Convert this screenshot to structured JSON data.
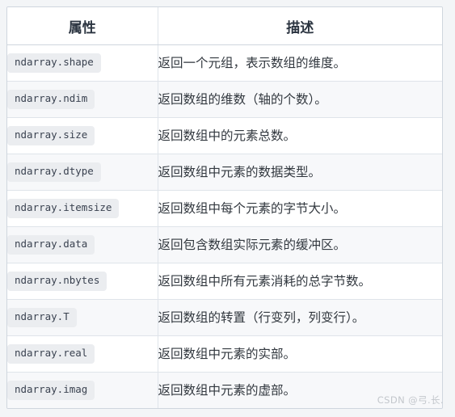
{
  "table": {
    "headers": [
      "属性",
      "描述"
    ],
    "rows": [
      {
        "attr": "ndarray.shape",
        "desc": "返回一个元组，表示数组的维度。"
      },
      {
        "attr": "ndarray.ndim",
        "desc": "返回数组的维数（轴的个数）。"
      },
      {
        "attr": "ndarray.size",
        "desc": "返回数组中的元素总数。"
      },
      {
        "attr": "ndarray.dtype",
        "desc": "返回数组中元素的数据类型。"
      },
      {
        "attr": "ndarray.itemsize",
        "desc": "返回数组中每个元素的字节大小。"
      },
      {
        "attr": "ndarray.data",
        "desc": "返回包含数组实际元素的缓冲区。"
      },
      {
        "attr": "ndarray.nbytes",
        "desc": "返回数组中所有元素消耗的总字节数。"
      },
      {
        "attr": "ndarray.T",
        "desc": "返回数组的转置（行变列，列变行）。"
      },
      {
        "attr": "ndarray.real",
        "desc": "返回数组中元素的实部。"
      },
      {
        "attr": "ndarray.imag",
        "desc": "返回数组中元素的虚部。"
      }
    ]
  },
  "watermark": {
    "text": "CSDN @弓.长."
  },
  "colors": {
    "page_background": "#f3f5f7",
    "table_border": "#cfd6de",
    "row_divider": "#dfe4ea",
    "stripe_row": "#f7f8fa",
    "chip_background": "#ebedf0",
    "chip_text": "#3a4250",
    "header_text": "#2b3440",
    "body_text": "#32383f",
    "watermark_text": "#c3c7cc"
  }
}
